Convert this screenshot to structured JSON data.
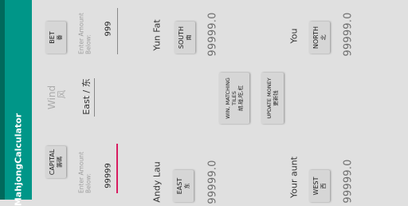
{
  "app": {
    "title": "MahjongCalculator"
  },
  "bet": {
    "button_en": "BET",
    "button_zh": "番",
    "hint": "Enter Amount Below:",
    "value": "999"
  },
  "capital": {
    "button_en": "CAPITAL",
    "button_zh": "籌碼",
    "hint": "Enter Amount Below:",
    "value": "99999"
  },
  "wind": {
    "label_en": "Wind",
    "label_zh": "风",
    "value": "East / 东"
  },
  "players": [
    {
      "name": "Yun Fat",
      "seat_en": "SOUTH",
      "seat_zh": "南",
      "score": "99999.0"
    },
    {
      "name": "You",
      "seat_en": "NORTH",
      "seat_zh": "北",
      "score": "99999.0"
    },
    {
      "name": "Andy Lau",
      "seat_en": "EAST",
      "seat_zh": "东",
      "score": "99999.0"
    },
    {
      "name": "Your aunt",
      "seat_en": "WEST",
      "seat_zh": "西",
      "score": "99999.0"
    }
  ],
  "actions": {
    "win": {
      "line1": "WIN, MATCHING",
      "line2": "TILES",
      "line3": "胡,碰,吃,杠"
    },
    "update": {
      "line1": "UPDATE MONEY",
      "line2": "更新钱"
    }
  },
  "colors": {
    "app_bar": "#009688",
    "status_bar": "#00695c",
    "accent": "#d81b60"
  }
}
